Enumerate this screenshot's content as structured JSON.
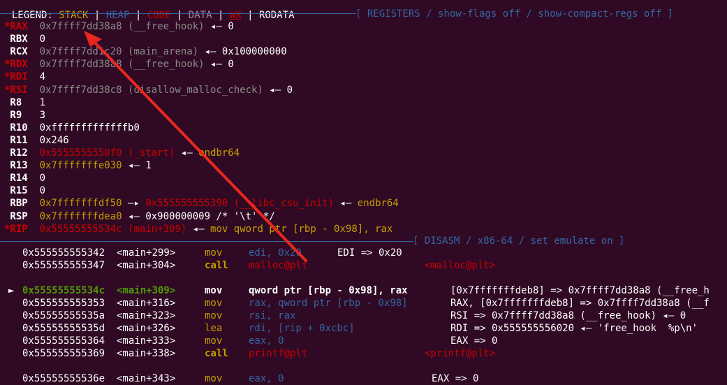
{
  "legend": {
    "prefix": "LEGEND: ",
    "stack": "STACK",
    "sep": " | ",
    "heap": "HEAP",
    "code": "CODE",
    "data": "DATA",
    "wx": "WX",
    "rodata": "RODATA"
  },
  "registers_banner": "[ REGISTERS / show-flags off / show-compact-regs off ]",
  "registers": [
    {
      "name": "*RAX",
      "changed": true,
      "value": "0x7ffff7dd38a8",
      "sym": "(__free_hook)",
      "arrow": " ◂— ",
      "target": "0"
    },
    {
      "name": " RBX",
      "changed": false,
      "value": "0",
      "sym": "",
      "arrow": "",
      "target": ""
    },
    {
      "name": " RCX",
      "changed": false,
      "value": "0x7ffff7dd1c20",
      "sym": "(main_arena)",
      "arrow": " ◂— ",
      "target": "0x100000000"
    },
    {
      "name": "*RDX",
      "changed": true,
      "value": "0x7ffff7dd38a8",
      "sym": "(__free_hook)",
      "arrow": " ◂— ",
      "target": "0"
    },
    {
      "name": "*RDI",
      "changed": true,
      "value": "4",
      "sym": "",
      "arrow": "",
      "target": ""
    },
    {
      "name": "*RSI",
      "changed": true,
      "value": "0x7ffff7dd38c8",
      "sym": "(disallow_malloc_check)",
      "arrow": " ◂— ",
      "target": "0"
    },
    {
      "name": " R8",
      "changed": false,
      "value": "1",
      "sym": "",
      "arrow": "",
      "target": ""
    },
    {
      "name": " R9",
      "changed": false,
      "value": "3",
      "sym": "",
      "arrow": "",
      "target": ""
    },
    {
      "name": " R10",
      "changed": false,
      "value": "0xfffffffffffffb0",
      "sym": "",
      "arrow": "",
      "target": ""
    },
    {
      "name": " R11",
      "changed": false,
      "value": "0x246",
      "sym": "",
      "arrow": "",
      "target": ""
    },
    {
      "name": " R12",
      "changed": false,
      "value": "0x5555555550f0",
      "sym": "(_start)",
      "arrow": " ◂— ",
      "target": "endbr64"
    },
    {
      "name": " R13",
      "changed": false,
      "value": "0x7fffffffe030",
      "sym": "",
      "arrow": " ◂— ",
      "target": "1"
    },
    {
      "name": " R14",
      "changed": false,
      "value": "0",
      "sym": "",
      "arrow": "",
      "target": ""
    },
    {
      "name": " R15",
      "changed": false,
      "value": "0",
      "sym": "",
      "arrow": "",
      "target": ""
    },
    {
      "name": " RBP",
      "changed": false,
      "value": "0x7fffffffdf50",
      "sym": "",
      "arrow": " —▸ ",
      "target": "0x555555555390",
      "sym2": "(__libc_csu_init)",
      "arrow2": " ◂— ",
      "target2": "endbr64"
    },
    {
      "name": " RSP",
      "changed": false,
      "value": "0x7fffffffdea0",
      "sym": "",
      "arrow": " ◂— ",
      "target": "0x900000009 /* '\\t' */"
    },
    {
      "name": "*RIP",
      "changed": true,
      "value": "0x55555555534c",
      "sym": "(main+309)",
      "arrow": " ◂— ",
      "target": "mov qword ptr [rbp - 0x98], rax"
    }
  ],
  "disasm_banner": "[ DISASM / x86-64 / set emulate on ]",
  "disasm": [
    {
      "cur": false,
      "addr": "0x555555555342",
      "loc": "<main+299>",
      "mn": "mov",
      "ops": "edi, 0x20",
      "note": "EDI => 0x20"
    },
    {
      "cur": false,
      "addr": "0x555555555347",
      "loc": "<main+304>",
      "mn": "call",
      "ops": "malloc@plt",
      "note": "<malloc@plt>"
    },
    {
      "cur": true,
      "marker": "►",
      "addr": "0x55555555534c",
      "loc": "<main+309>",
      "mn": "mov",
      "ops": "qword ptr [rbp - 0x98], rax",
      "note": "[0x7fffffffdeb8] => 0x7ffff7dd38a8 (__free_h"
    },
    {
      "cur": false,
      "addr": "0x555555555353",
      "loc": "<main+316>",
      "mn": "mov",
      "ops": "rax, qword ptr [rbp - 0x98]",
      "note": "RAX, [0x7fffffffdeb8] => 0x7ffff7dd38a8 (__f"
    },
    {
      "cur": false,
      "addr": "0x55555555535a",
      "loc": "<main+323>",
      "mn": "mov",
      "ops": "rsi, rax",
      "note": "RSI => 0x7ffff7dd38a8 (__free_hook) ◂— 0"
    },
    {
      "cur": false,
      "addr": "0x55555555535d",
      "loc": "<main+326>",
      "mn": "lea",
      "ops": "rdi, [rip + 0xcbc]",
      "note": "RDI => 0x555555556020 ◂— 'free_hook  %p\\n'"
    },
    {
      "cur": false,
      "addr": "0x555555555364",
      "loc": "<main+333>",
      "mn": "mov",
      "ops": "eax, 0",
      "note": "EAX => 0"
    },
    {
      "cur": false,
      "addr": "0x555555555369",
      "loc": "<main+338>",
      "mn": "call",
      "ops": "printf@plt",
      "note": "<printf@plt>"
    },
    {
      "cur": false,
      "addr": "0x55555555536e",
      "loc": "<main+343>",
      "mn": "mov",
      "ops": "eax, 0",
      "note": "EAX => 0"
    }
  ],
  "colors": {
    "background": "#300a24",
    "annotation_arrow": "#e8281e"
  }
}
